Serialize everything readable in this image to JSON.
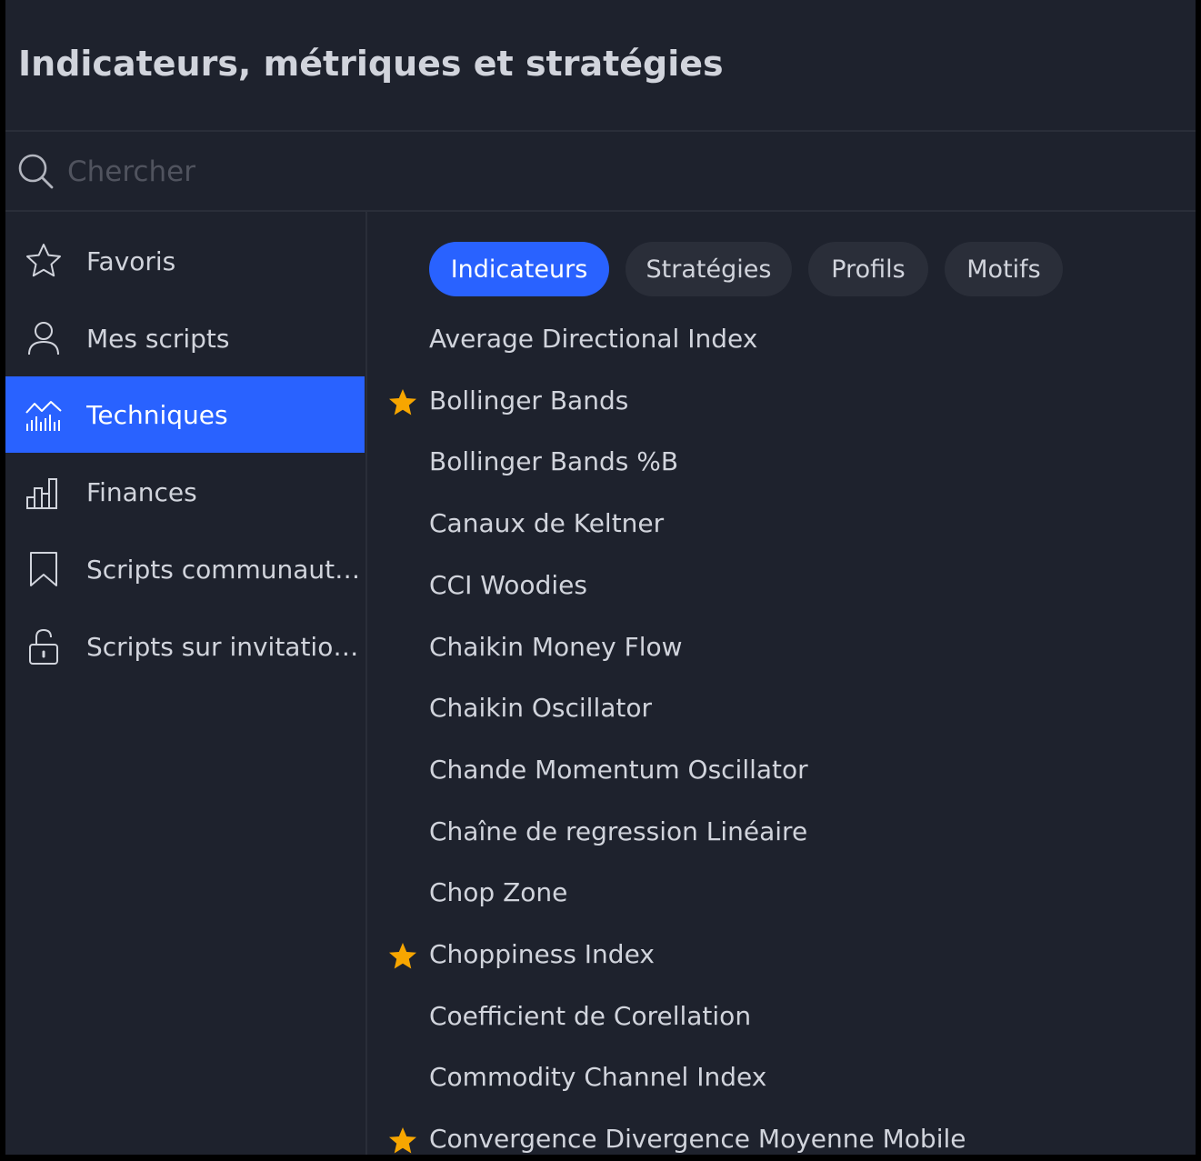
{
  "dialog": {
    "title": "Indicateurs, métriques et stratégies"
  },
  "search": {
    "placeholder": "Chercher",
    "value": ""
  },
  "sidebar": {
    "items": [
      {
        "label": "Favoris",
        "icon": "star-outline-icon"
      },
      {
        "label": "Mes scripts",
        "icon": "user-icon"
      },
      {
        "label": "Techniques",
        "icon": "technical-chart-icon",
        "active": true
      },
      {
        "label": "Finances",
        "icon": "bar-chart-icon"
      },
      {
        "label": "Scripts communautaires",
        "icon": "bookmark-icon"
      },
      {
        "label": "Scripts sur invitation uniquement",
        "icon": "lock-icon"
      }
    ]
  },
  "tabs": [
    {
      "label": "Indicateurs",
      "active": true
    },
    {
      "label": "Stratégies"
    },
    {
      "label": "Profils"
    },
    {
      "label": "Motifs"
    }
  ],
  "indicators": [
    {
      "name": "Average Directional Index",
      "favorite": false
    },
    {
      "name": "Bollinger Bands",
      "favorite": true
    },
    {
      "name": "Bollinger Bands %B",
      "favorite": false
    },
    {
      "name": "Canaux de Keltner",
      "favorite": false
    },
    {
      "name": "CCI Woodies",
      "favorite": false
    },
    {
      "name": "Chaikin Money Flow",
      "favorite": false
    },
    {
      "name": "Chaikin Oscillator",
      "favorite": false
    },
    {
      "name": "Chande Momentum Oscillator",
      "favorite": false
    },
    {
      "name": "Chaîne de regression Linéaire",
      "favorite": false
    },
    {
      "name": "Chop Zone",
      "favorite": false
    },
    {
      "name": "Choppiness Index",
      "favorite": true
    },
    {
      "name": "Coefficient de Corellation",
      "favorite": false
    },
    {
      "name": "Commodity Channel Index",
      "favorite": false
    },
    {
      "name": "Convergence Divergence Moyenne Mobile",
      "favorite": true
    }
  ],
  "colors": {
    "accent": "#2962ff",
    "star": "#f7a600",
    "background": "#1e222d",
    "text": "#d1d4dc"
  }
}
